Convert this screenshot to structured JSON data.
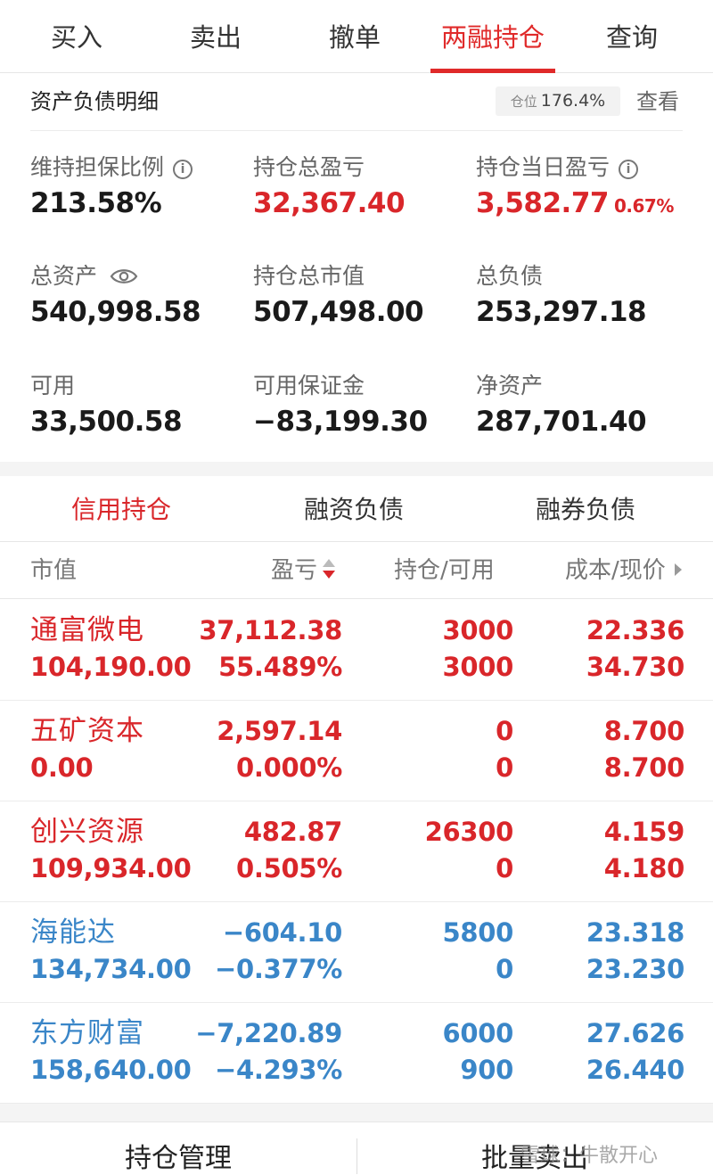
{
  "top_tabs": [
    "买入",
    "卖出",
    "撤单",
    "两融持仓",
    "查询"
  ],
  "asset_section": {
    "title": "资产负债明细",
    "position_label": "仓位",
    "position_value": "176.4%",
    "view_label": "查看"
  },
  "metrics": {
    "maintenance_ratio": {
      "label": "维持担保比例",
      "value": "213.58%"
    },
    "total_pnl": {
      "label": "持仓总盈亏",
      "value": "32,367.40"
    },
    "daily_pnl": {
      "label": "持仓当日盈亏",
      "value": "3,582.77",
      "pct": "0.67%"
    },
    "total_assets": {
      "label": "总资产",
      "value": "540,998.58"
    },
    "market_value": {
      "label": "持仓总市值",
      "value": "507,498.00"
    },
    "total_liabilities": {
      "label": "总负债",
      "value": "253,297.18"
    },
    "available": {
      "label": "可用",
      "value": "33,500.58"
    },
    "available_margin": {
      "label": "可用保证金",
      "value": "−83,199.30"
    },
    "net_assets": {
      "label": "净资产",
      "value": "287,701.40"
    }
  },
  "sub_tabs": [
    "信用持仓",
    "融资负债",
    "融券负债"
  ],
  "table_header": {
    "market_value": "市值",
    "pnl": "盈亏",
    "position": "持仓/可用",
    "cost": "成本/现价"
  },
  "holdings": [
    {
      "name": "通富微电",
      "market_value": "104,190.00",
      "pnl": "37,112.38",
      "pnl_pct": "55.489%",
      "position": "3000",
      "available": "3000",
      "cost": "22.336",
      "price": "34.730",
      "color": "#d9262a"
    },
    {
      "name": "五矿资本",
      "market_value": "0.00",
      "pnl": "2,597.14",
      "pnl_pct": "0.000%",
      "position": "0",
      "available": "0",
      "cost": "8.700",
      "price": "8.700",
      "color": "#d9262a"
    },
    {
      "name": "创兴资源",
      "market_value": "109,934.00",
      "pnl": "482.87",
      "pnl_pct": "0.505%",
      "position": "26300",
      "available": "0",
      "cost": "4.159",
      "price": "4.180",
      "color": "#d9262a"
    },
    {
      "name": "海能达",
      "market_value": "134,734.00",
      "pnl": "−604.10",
      "pnl_pct": "−0.377%",
      "position": "5800",
      "available": "0",
      "cost": "23.318",
      "price": "23.230",
      "color": "#3a86c8"
    },
    {
      "name": "东方财富",
      "market_value": "158,640.00",
      "pnl": "−7,220.89",
      "pnl_pct": "−4.293%",
      "position": "6000",
      "available": "900",
      "cost": "27.626",
      "price": "26.440",
      "color": "#3a86c8"
    }
  ],
  "bottom_bar": {
    "manage": "持仓管理",
    "batch_sell": "批量卖出"
  },
  "watermark": "雪球：牛散开心",
  "colors": {
    "accent_red": "#d9262a",
    "loss_blue": "#3a86c8"
  }
}
